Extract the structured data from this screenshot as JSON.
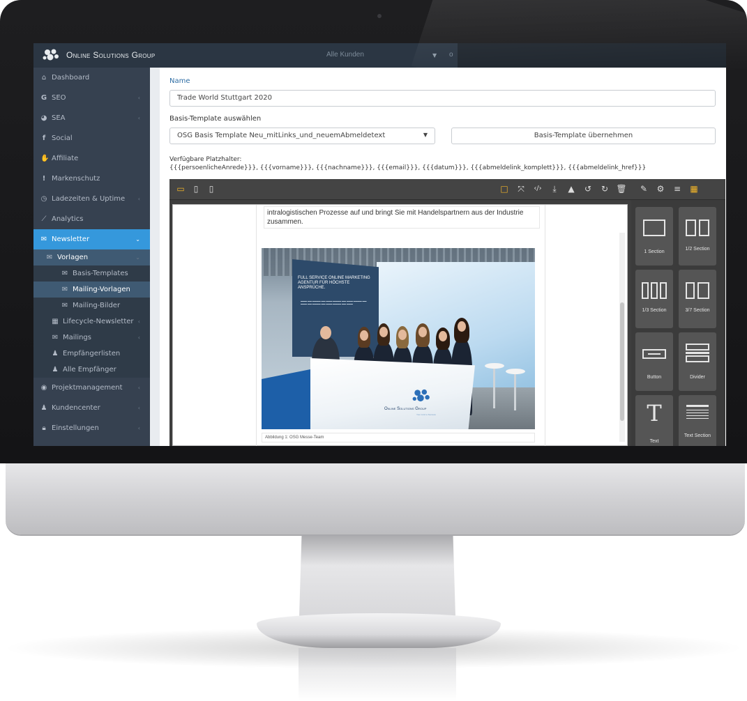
{
  "app": {
    "brand": "Online Solutions Group",
    "customer_select": "Alle Kunden",
    "topbar_extra": "o"
  },
  "sidebar": {
    "items": [
      {
        "label": "Dashboard",
        "icon": "home-icon"
      },
      {
        "label": "SEO",
        "icon": "google-icon"
      },
      {
        "label": "SEA",
        "icon": "pie-chart-icon"
      },
      {
        "label": "Social",
        "icon": "facebook-icon"
      },
      {
        "label": "Affiliate",
        "icon": "handshake-icon"
      },
      {
        "label": "Markenschutz",
        "icon": "exclamation-icon"
      },
      {
        "label": "Ladezeiten & Uptime",
        "icon": "clock-icon"
      },
      {
        "label": "Analytics",
        "icon": "area-chart-icon"
      },
      {
        "label": "Newsletter",
        "icon": "envelope-icon"
      },
      {
        "label": "Vorlagen",
        "icon": "envelope-icon"
      },
      {
        "label": "Basis-Templates",
        "icon": "envelope-icon"
      },
      {
        "label": "Mailing-Vorlagen",
        "icon": "envelope-icon"
      },
      {
        "label": "Mailing-Bilder",
        "icon": "envelope-icon"
      },
      {
        "label": "Lifecycle-Newsletter",
        "icon": "calendar-icon"
      },
      {
        "label": "Mailings",
        "icon": "envelope-icon"
      },
      {
        "label": "Empfängerlisten",
        "icon": "user-icon"
      },
      {
        "label": "Alle Empfänger",
        "icon": "user-icon"
      },
      {
        "label": "Projektmanagement",
        "icon": "binoculars-icon"
      },
      {
        "label": "Kundencenter",
        "icon": "users-icon"
      },
      {
        "label": "Einstellungen",
        "icon": "lock-icon"
      }
    ]
  },
  "form": {
    "name_label": "Name",
    "name_value": "Trade World Stuttgart 2020",
    "template_label": "Basis-Template auswählen",
    "template_value": "OSG Basis Template Neu_mitLinks_und_neuemAbmeldetext",
    "apply_button": "Basis-Template übernehmen",
    "placeholders_label": "Verfügbare Platzhalter:",
    "placeholders_value": "{{{persoenlicheAnrede}}}, {{{vorname}}}, {{{nachname}}}, {{{email}}}, {{{datum}}}, {{{abmeldelink_komplett}}}, {{{abmeldelink_href}}}"
  },
  "editor": {
    "mail_text": "intralogistischen Prozesse auf und bringt Sie mit Handelspartnern aus der Industrie zusammen.",
    "caption": "Abbildung 1: OSG Messe-Team",
    "photo": {
      "banner_title": "FULL SERVICE ONLINE MARKETING AGENTUR FÜR HÖCHSTE ANSPRÜCHE.",
      "counter_brand": "Online Solutions Group",
      "counter_tagline": "Your Link to Success"
    },
    "blocks": [
      {
        "label": "1 Section",
        "shape": "one-col"
      },
      {
        "label": "1/2 Section",
        "shape": "two-col"
      },
      {
        "label": "1/3 Section",
        "shape": "three-col"
      },
      {
        "label": "3/7 Section",
        "shape": "two-col-uneven"
      },
      {
        "label": "Button",
        "shape": "button"
      },
      {
        "label": "Divider",
        "shape": "divider"
      },
      {
        "label": "Text",
        "shape": "text"
      },
      {
        "label": "Text Section",
        "shape": "text-lines"
      }
    ]
  },
  "colors": {
    "accent": "#3598dc",
    "toolbar_active": "#f0b429",
    "sidebar_bg": "#364150"
  }
}
